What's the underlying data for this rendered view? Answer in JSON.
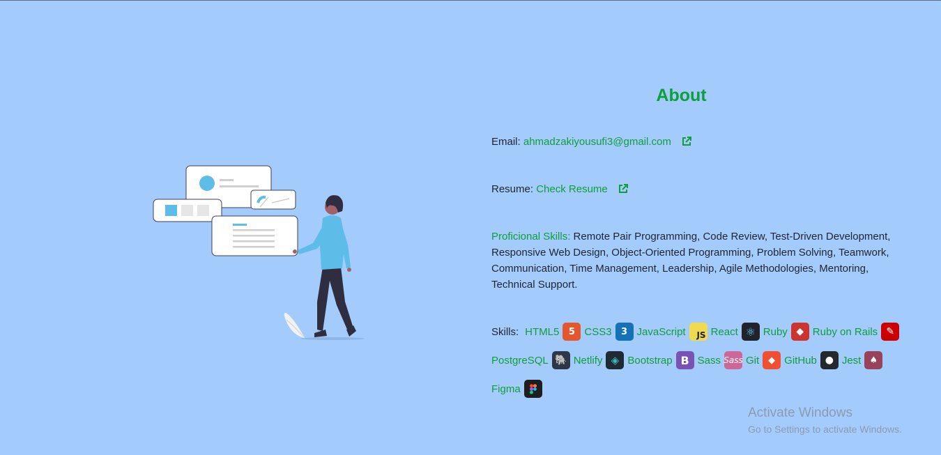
{
  "about": {
    "title": "About",
    "email_label": "Email:",
    "email_value": "ahmadzakiyousufi3@gmail.com",
    "resume_label": "Resume:",
    "resume_link": "Check Resume",
    "proficient_label": "Proficional Skills:",
    "proficient_text": " Remote Pair Programming, Code Review, Test-Driven Development, Responsive Web Design, Object-Oriented Programming, Problem Solving, Teamwork, Communication, Time Management, Leadership, Agile Methodologies, Mentoring, Technical Support.",
    "skills_label": "Skills:",
    "skills": {
      "html5": "HTML5",
      "css3": "CSS3",
      "javascript": "JavaScript",
      "react": "React",
      "ruby": "Ruby",
      "rails": "Ruby on Rails",
      "postgresql": "PostgreSQL",
      "netlify": "Netlify",
      "bootstrap": "Bootstrap",
      "sass": "Sass",
      "git": "Git",
      "github": "GitHub",
      "jest": "Jest",
      "figma": "Figma"
    },
    "badge_text": {
      "html5": "5",
      "css3": "3",
      "javascript": "JS",
      "react": "⚛",
      "ruby": "◆",
      "rails": "✎",
      "postgresql": "🐘",
      "netlify": "◈",
      "bootstrap": "B",
      "sass": "Sass",
      "git": "◆",
      "github": "●",
      "jest": "♠"
    }
  },
  "watermark": {
    "line1": "Activate Windows",
    "line2": "Go to Settings to activate Windows."
  },
  "colors": {
    "background": "#a3cbfc",
    "accent_green": "#0e9f3a",
    "text": "#1f2530"
  },
  "icons": [
    "external-link-icon",
    "html5-icon",
    "css3-icon",
    "javascript-icon",
    "react-icon",
    "ruby-icon",
    "rails-icon",
    "postgresql-icon",
    "netlify-icon",
    "bootstrap-icon",
    "sass-icon",
    "git-icon",
    "github-icon",
    "jest-icon",
    "figma-icon"
  ]
}
